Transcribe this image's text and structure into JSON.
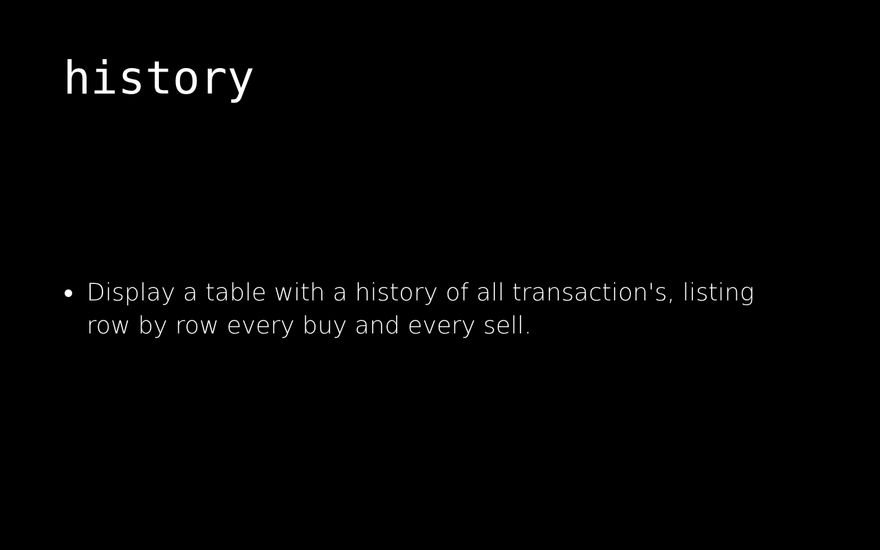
{
  "slide": {
    "title": "history",
    "bullets": [
      {
        "text": "Display a table with a history of all transaction's, listing row by row every buy and every sell."
      }
    ]
  },
  "colors": {
    "background": "#000000",
    "text": "#ffffff"
  }
}
